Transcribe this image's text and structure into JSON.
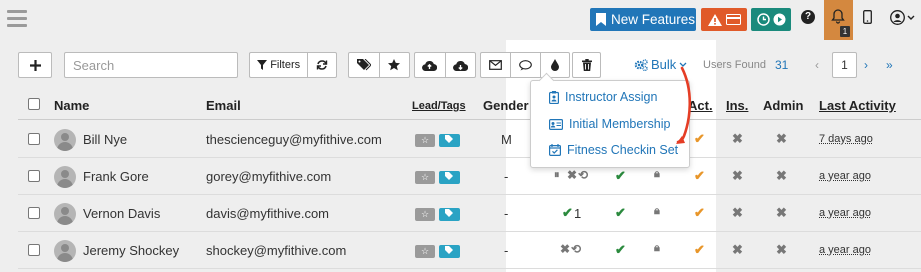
{
  "topbar": {
    "new_features_label": "New Features",
    "notification_count": "1"
  },
  "toolbar": {
    "filters_label": "Filters",
    "bulk_label": "Bulk",
    "search_placeholder": "Search"
  },
  "results": {
    "users_found_label": "Users Found",
    "users_found_count": "31",
    "page_number": "1"
  },
  "table": {
    "columns": {
      "name": "Name",
      "email": "Email",
      "lead_tags": "Lead/Tags",
      "gender": "Gender",
      "act": "Act.",
      "ins": "Ins.",
      "admin": "Admin",
      "last_activity": "Last Activity"
    },
    "rows": [
      {
        "name": "Bill Nye",
        "email": "thescienceguy@myfithive.com",
        "gender": "M",
        "last_activity": "7 days ago"
      },
      {
        "name": "Frank Gore",
        "email": "gorey@myfithive.com",
        "gender": "-",
        "last_activity": "a year ago"
      },
      {
        "name": "Vernon Davis",
        "email": "davis@myfithive.com",
        "gender": "-",
        "checkins": "1",
        "last_activity": "a year ago"
      },
      {
        "name": "Jeremy Shockey",
        "email": "shockey@myfithive.com",
        "gender": "-",
        "last_activity": "a year ago"
      }
    ]
  },
  "bulk_menu": {
    "items": [
      "Instructor Assign",
      "Initial Membership",
      "Fitness Checkin Set"
    ]
  },
  "colors": {
    "primary": "#2176b8",
    "alert": "#e05a29",
    "teal": "#1a8a7c",
    "bell_active": "#d4883f",
    "annotation_arrow": "#e53d25"
  }
}
